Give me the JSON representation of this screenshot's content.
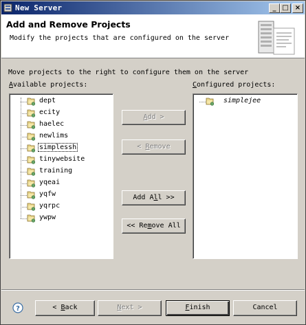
{
  "window": {
    "title": "New Server",
    "controls": {
      "minimize": "_",
      "maximize": "□",
      "close": "×"
    }
  },
  "header": {
    "title": "Add and Remove Projects",
    "description": "Modify the projects that are configured on the server",
    "image_icon": "server-document-icon"
  },
  "instruction": "Move projects to the right to configure them on the server",
  "available": {
    "label_prefix": "",
    "label_mnemonic": "A",
    "label_rest": "vailable projects:",
    "items": [
      {
        "label": "dept"
      },
      {
        "label": "ecity"
      },
      {
        "label": "haelec"
      },
      {
        "label": "newlims"
      },
      {
        "label": "simplessh"
      },
      {
        "label": "tinywebsite"
      },
      {
        "label": "training"
      },
      {
        "label": "yqeai"
      },
      {
        "label": "yqfw"
      },
      {
        "label": "yqrpc"
      },
      {
        "label": "ywpw"
      }
    ]
  },
  "configured": {
    "label_prefix": "",
    "label_mnemonic": "C",
    "label_rest": "onfigured projects:",
    "items": [
      {
        "label": "simplejee"
      }
    ]
  },
  "buttons": {
    "add": {
      "pre": "",
      "mn": "A",
      "post": "dd >"
    },
    "remove": {
      "pre": "< ",
      "mn": "R",
      "post": "emove"
    },
    "add_all": {
      "pre": "Add A",
      "mn": "l",
      "post": "l >>"
    },
    "remove_all": {
      "pre": "<< Re",
      "mn": "m",
      "post": "ove All"
    },
    "back": {
      "pre": "< ",
      "mn": "B",
      "post": "ack"
    },
    "next": {
      "pre": "",
      "mn": "N",
      "post": "ext >"
    },
    "finish": {
      "pre": "",
      "mn": "F",
      "post": "inish"
    },
    "cancel": {
      "pre": "",
      "mn": "",
      "post": "Cancel"
    }
  },
  "help_icon": "help-icon",
  "colors": {
    "title_gradient_start": "#0a246a",
    "title_gradient_end": "#a6caf0",
    "dialog_bg": "#d4d0c8"
  }
}
